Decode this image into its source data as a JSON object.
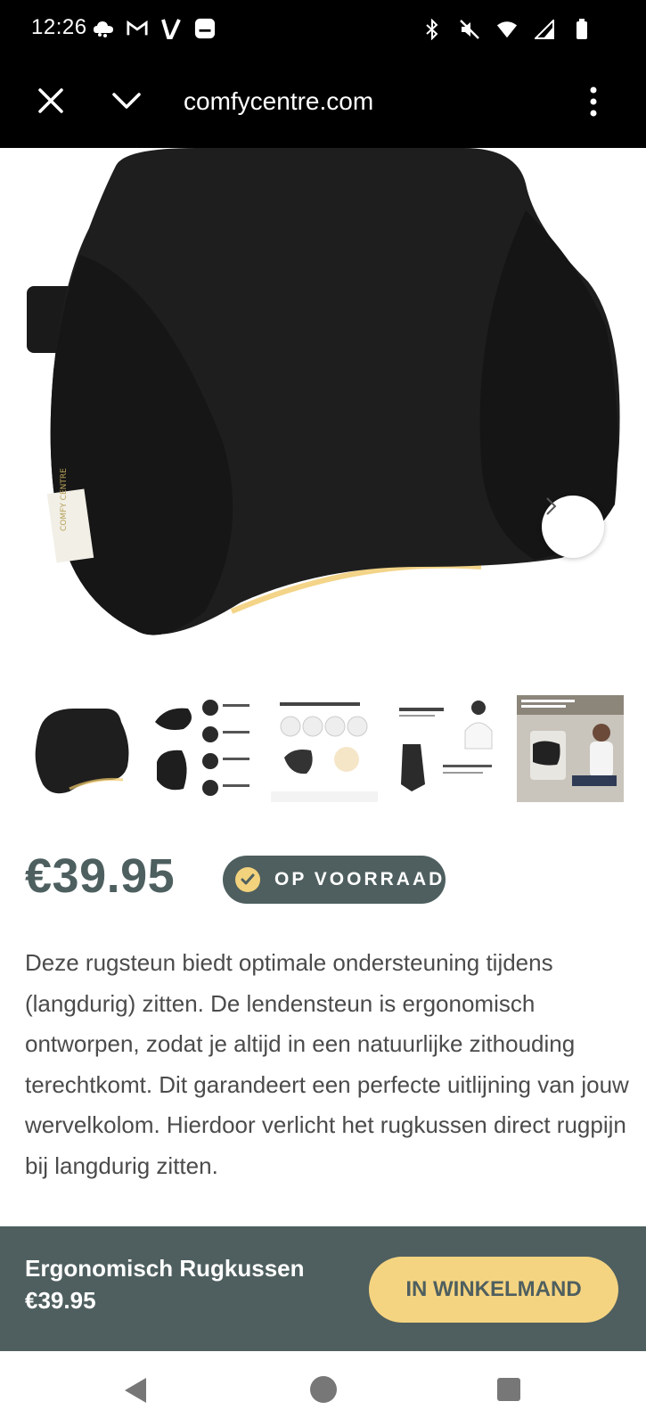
{
  "status_bar": {
    "time": "12:26",
    "left_icons": [
      "cloud-icon",
      "gmail-icon",
      "v-app-icon",
      "messaging-icon"
    ],
    "right_icons": [
      "bluetooth-icon",
      "mute-icon",
      "wifi-icon",
      "signal-icon",
      "battery-icon"
    ]
  },
  "browser": {
    "url": "comfycentre.com"
  },
  "product": {
    "image_label": "COMFY CENTRE",
    "thumbnails": [
      {
        "name": "thumb-front-view",
        "text": ""
      },
      {
        "name": "thumb-features",
        "text": "Adjustable Strap"
      },
      {
        "name": "thumb-relieve-pain",
        "text": "Relieve hip-, leg- or back pain"
      },
      {
        "name": "thumb-ergonomic-chair",
        "text": "Create an ergonomic chair"
      },
      {
        "name": "thumb-adjust-height",
        "text": "Easy to adjust in height for your optimal support"
      }
    ],
    "price": "€39.95",
    "stock_status": "OP VOORRAAD",
    "description": "Deze rugsteun biedt optimale ondersteuning tijdens (langdurig) zitten. De lendensteun is ergonomisch ontworpen, zodat je altijd in een natuurlijke zithouding terechtkomt. Dit garandeert een perfecte uitlijning van jouw wervelkolom. Hierdoor verlicht het rugkussen direct rugpijn bij langdurig zitten."
  },
  "cart_bar": {
    "product_name": "Ergonomisch Rugkussen",
    "price": "€39.95",
    "button_label": "IN WINKELMAND"
  },
  "colors": {
    "brand_dark": "#4f5f5f",
    "accent_yellow": "#f5d481"
  }
}
